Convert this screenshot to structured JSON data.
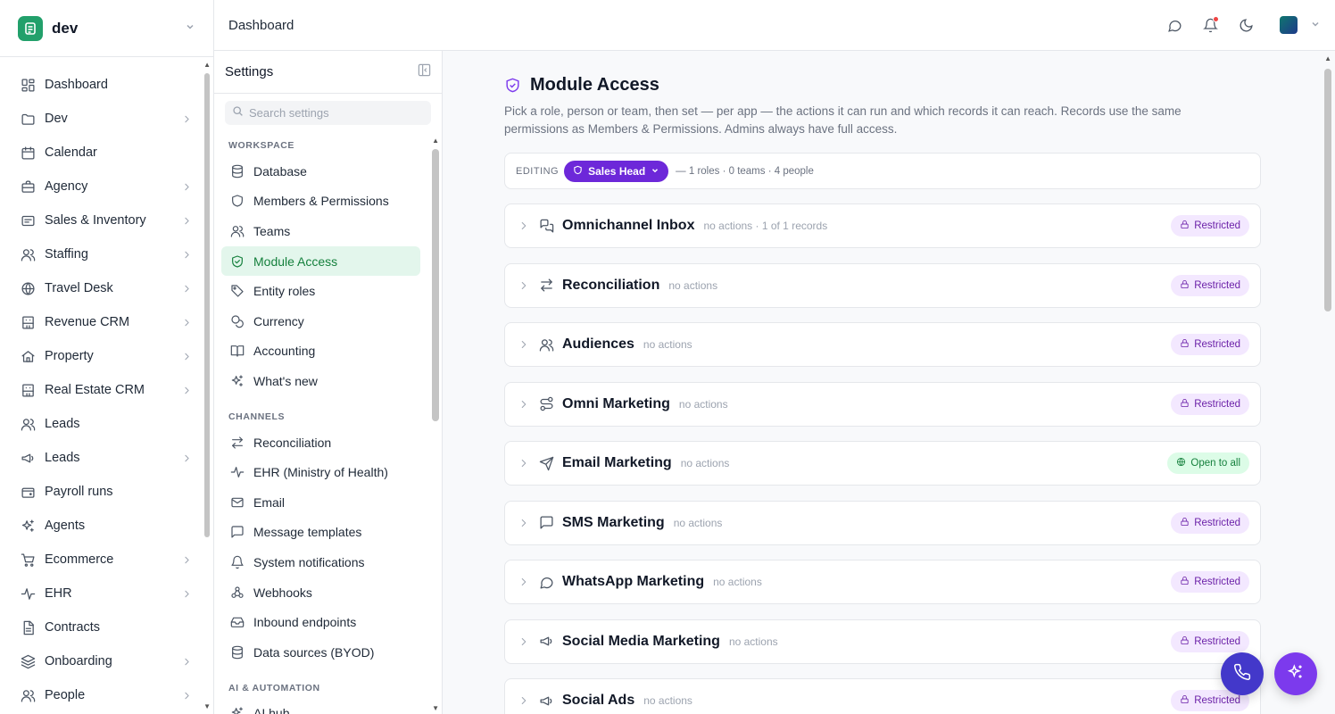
{
  "workspace": {
    "name": "dev"
  },
  "nav": [
    {
      "label": "Dashboard",
      "icon": "grid-icon",
      "chevron": false
    },
    {
      "label": "Dev",
      "icon": "folder-icon",
      "chevron": true
    },
    {
      "label": "Calendar",
      "icon": "calendar-icon",
      "chevron": false
    },
    {
      "label": "Agency",
      "icon": "briefcase-icon",
      "chevron": true
    },
    {
      "label": "Sales & Inventory",
      "icon": "receipt-icon",
      "chevron": true
    },
    {
      "label": "Staffing",
      "icon": "users-icon",
      "chevron": true
    },
    {
      "label": "Travel Desk",
      "icon": "globe-icon",
      "chevron": true
    },
    {
      "label": "Revenue CRM",
      "icon": "building-icon",
      "chevron": true
    },
    {
      "label": "Property",
      "icon": "home-icon",
      "chevron": true
    },
    {
      "label": "Real Estate CRM",
      "icon": "building-icon",
      "chevron": true
    },
    {
      "label": "Leads",
      "icon": "users-icon",
      "chevron": false
    },
    {
      "label": "Leads",
      "icon": "megaphone-icon",
      "chevron": true
    },
    {
      "label": "Payroll runs",
      "icon": "wallet-icon",
      "chevron": false
    },
    {
      "label": "Agents",
      "icon": "sparkles-icon",
      "chevron": false
    },
    {
      "label": "Ecommerce",
      "icon": "cart-icon",
      "chevron": true
    },
    {
      "label": "EHR",
      "icon": "pulse-icon",
      "chevron": true
    },
    {
      "label": "Contracts",
      "icon": "file-icon",
      "chevron": false
    },
    {
      "label": "Onboarding",
      "icon": "stack-icon",
      "chevron": true
    },
    {
      "label": "People",
      "icon": "users-icon",
      "chevron": true
    }
  ],
  "topbar": {
    "breadcrumb": "Dashboard"
  },
  "settings": {
    "title": "Settings",
    "search_placeholder": "Search settings",
    "sections": [
      {
        "label": "WORKSPACE",
        "items": [
          {
            "label": "Database",
            "icon": "database-icon",
            "active": false
          },
          {
            "label": "Members & Permissions",
            "icon": "shield-icon",
            "active": false
          },
          {
            "label": "Teams",
            "icon": "users-icon",
            "active": false
          },
          {
            "label": "Module Access",
            "icon": "shield-check-icon",
            "active": true
          },
          {
            "label": "Entity roles",
            "icon": "tags-icon",
            "active": false
          },
          {
            "label": "Currency",
            "icon": "coins-icon",
            "active": false
          },
          {
            "label": "Accounting",
            "icon": "book-icon",
            "active": false
          },
          {
            "label": "What's new",
            "icon": "sparkles-icon",
            "active": false
          }
        ]
      },
      {
        "label": "CHANNELS",
        "items": [
          {
            "label": "Reconciliation",
            "icon": "arrows-icon",
            "active": false
          },
          {
            "label": "EHR (Ministry of Health)",
            "icon": "pulse-icon",
            "active": false
          },
          {
            "label": "Email",
            "icon": "mail-icon",
            "active": false
          },
          {
            "label": "Message templates",
            "icon": "message-icon",
            "active": false
          },
          {
            "label": "System notifications",
            "icon": "bell-icon",
            "active": false
          },
          {
            "label": "Webhooks",
            "icon": "webhook-icon",
            "active": false
          },
          {
            "label": "Inbound endpoints",
            "icon": "inbox-icon",
            "active": false
          },
          {
            "label": "Data sources (BYOD)",
            "icon": "database-icon",
            "active": false
          }
        ]
      },
      {
        "label": "AI & AUTOMATION",
        "items": [
          {
            "label": "AI hub",
            "icon": "sparkles-icon",
            "active": false
          }
        ]
      }
    ]
  },
  "main": {
    "title": "Module Access",
    "description": "Pick a role, person or team, then set — per app — the actions it can run and which records it can reach. Records use the same permissions as Members & Permissions. Admins always have full access.",
    "editing": {
      "label": "EDITING",
      "role": "Sales Head",
      "meta": "— 1 roles · 0 teams · 4 people"
    },
    "modules": [
      {
        "name": "Omnichannel Inbox",
        "sub": "no actions · 1 of 1 records",
        "icon": "chat-icon",
        "status": "Restricted",
        "open": false
      },
      {
        "name": "Reconciliation",
        "sub": "no actions",
        "icon": "arrows-icon",
        "status": "Restricted",
        "open": false
      },
      {
        "name": "Audiences",
        "sub": "no actions",
        "icon": "users-icon",
        "status": "Restricted",
        "open": false
      },
      {
        "name": "Omni Marketing",
        "sub": "no actions",
        "icon": "route-icon",
        "status": "Restricted",
        "open": false
      },
      {
        "name": "Email Marketing",
        "sub": "no actions",
        "icon": "send-icon",
        "status": "Open to all",
        "open": true
      },
      {
        "name": "SMS Marketing",
        "sub": "no actions",
        "icon": "message-square-icon",
        "status": "Restricted",
        "open": false
      },
      {
        "name": "WhatsApp Marketing",
        "sub": "no actions",
        "icon": "message-circle-icon",
        "status": "Restricted",
        "open": false
      },
      {
        "name": "Social Media Marketing",
        "sub": "no actions",
        "icon": "megaphone-icon",
        "status": "Restricted",
        "open": false
      },
      {
        "name": "Social Ads",
        "sub": "no actions",
        "icon": "megaphone-icon",
        "status": "Restricted",
        "open": false
      }
    ]
  },
  "colors": {
    "accent": "#6d28d9",
    "active_green": "#15803d",
    "brand": "#22a06b"
  }
}
